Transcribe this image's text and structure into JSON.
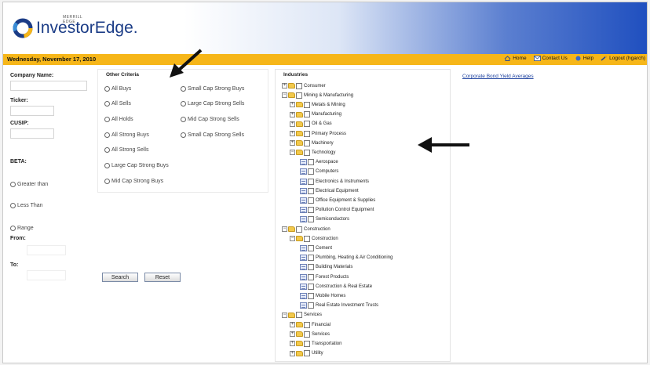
{
  "header": {
    "logo_small": "MERRILL EDGE",
    "logo_text": "InvestorEdge",
    "logo_suffix": "."
  },
  "bar": {
    "date": "Wednesday, November 17, 2010",
    "links": [
      {
        "label": "Home",
        "icon": "home-icon"
      },
      {
        "label": "Contact Us",
        "icon": "contact-icon"
      },
      {
        "label": "Help",
        "icon": "help-icon"
      },
      {
        "label": "Logout (hgarch)",
        "icon": "logout-icon"
      }
    ]
  },
  "left": {
    "company_label": "Company Name:",
    "ticker_label": "Ticker:",
    "cusip_label": "CUSIP:",
    "beta_label": "BETA:",
    "greater": "Greater than",
    "less": "Less Than",
    "range": "Range",
    "from": "From:",
    "to": "To:"
  },
  "other_criteria": {
    "title": "Other Criteria",
    "col1": [
      "All Buys",
      "All Sells",
      "All Holds",
      "All Strong Buys",
      "All Strong Sells",
      "Large Cap Strong Buys",
      "Mid Cap Strong Buys"
    ],
    "col2": [
      "Small Cap Strong Buys",
      "Large Cap Strong Sells",
      "Mid Cap Strong Sells",
      "Small Cap Strong Sells"
    ]
  },
  "buttons": {
    "search": "Search",
    "reset": "Reset"
  },
  "industries": {
    "title": "Industries",
    "tree": [
      {
        "label": "Consumer",
        "level": 0,
        "kind": "plus"
      },
      {
        "label": "Mining & Manufacturing",
        "level": 0,
        "kind": "minus"
      },
      {
        "label": "Metals & Mining",
        "level": 1,
        "kind": "plus"
      },
      {
        "label": "Manufacturing",
        "level": 1,
        "kind": "plus"
      },
      {
        "label": "Oil & Gas",
        "level": 1,
        "kind": "plus"
      },
      {
        "label": "Primary Process",
        "level": 1,
        "kind": "plus"
      },
      {
        "label": "Machinery",
        "level": 1,
        "kind": "plus"
      },
      {
        "label": "Technology",
        "level": 1,
        "kind": "minus"
      },
      {
        "label": "Aerospace",
        "level": 2,
        "kind": "leaf"
      },
      {
        "label": "Computers",
        "level": 2,
        "kind": "leaf"
      },
      {
        "label": "Electronics & Instruments",
        "level": 2,
        "kind": "leaf"
      },
      {
        "label": "Electrical Equipment",
        "level": 2,
        "kind": "leaf"
      },
      {
        "label": "Office Equipment & Supplies",
        "level": 2,
        "kind": "leaf"
      },
      {
        "label": "Pollution Control Equipment",
        "level": 2,
        "kind": "leaf"
      },
      {
        "label": "Semiconductors",
        "level": 2,
        "kind": "leaf"
      },
      {
        "label": "Construction",
        "level": 0,
        "kind": "minus"
      },
      {
        "label": "Construction",
        "level": 1,
        "kind": "minus"
      },
      {
        "label": "Cement",
        "level": 2,
        "kind": "leaf"
      },
      {
        "label": "Plumbing, Heating & Air Conditioning",
        "level": 2,
        "kind": "leaf"
      },
      {
        "label": "Building Materials",
        "level": 2,
        "kind": "leaf"
      },
      {
        "label": "Forest Products",
        "level": 2,
        "kind": "leaf"
      },
      {
        "label": "Construction & Real Estate",
        "level": 2,
        "kind": "leaf"
      },
      {
        "label": "Mobile Homes",
        "level": 2,
        "kind": "leaf"
      },
      {
        "label": "Real Estate Investment Trusts",
        "level": 2,
        "kind": "leaf"
      },
      {
        "label": "Services",
        "level": 0,
        "kind": "minus"
      },
      {
        "label": "Financial",
        "level": 1,
        "kind": "plus"
      },
      {
        "label": "Services",
        "level": 1,
        "kind": "plus"
      },
      {
        "label": "Transportation",
        "level": 1,
        "kind": "plus"
      },
      {
        "label": "Utility",
        "level": 1,
        "kind": "plus"
      }
    ]
  },
  "right": {
    "bond_link": "Corporate Bond Yield Averages"
  },
  "colors": {
    "bar": "#f6b619",
    "brand": "#1b3c86",
    "link": "#1a3f9e"
  }
}
